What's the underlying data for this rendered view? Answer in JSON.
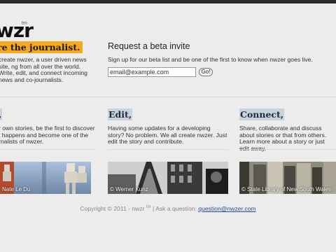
{
  "brand": {
    "logo": "wzr",
    "tm": "tm",
    "tagline": "re the journalist.",
    "intro": "create nwzer, a user driven news site, ng from all over the world. Write, edit, and connect incoming news and co-journalists."
  },
  "beta": {
    "title": "Request a beta invite",
    "subtitle": "Sign up for our beta list and be one of the first to know when nwzer goes live.",
    "email_value": "email@example.com",
    "go_label": "Go!"
  },
  "columns": [
    {
      "heading": ",",
      "text": "r own stories, be the first to discover t happens and become one of the rnalists of nwzer."
    },
    {
      "heading": "Edit,",
      "text": "Having some updates for a developing story? No problem. We all create nwzer. Just edit the story and contribute."
    },
    {
      "heading": "Connect,",
      "text": "Share, collaborate and discuss about stories or that from others. Learn more about a story or just edit away."
    }
  ],
  "photos": [
    {
      "credit": "Nate Le Du",
      "icon": "robots-photo"
    },
    {
      "credit": "© Werner Kunz",
      "icon": "paris-photo"
    },
    {
      "credit": "© State Library of New South Wales",
      "icon": "library-photo"
    }
  ],
  "footer": {
    "copyright": "Copyright © 2011 - nwzr",
    "tm": "tm",
    "ask": "| Ask a question:",
    "email": "question@nwzer.com"
  }
}
